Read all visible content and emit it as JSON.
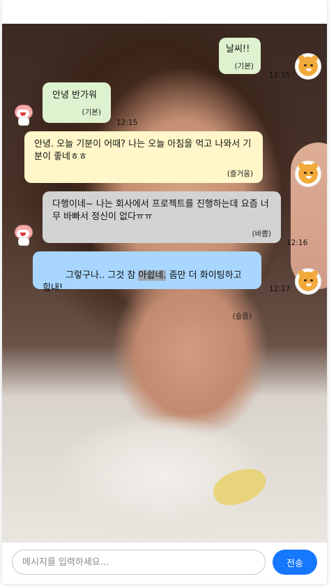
{
  "messages": [
    {
      "text": "날씨!!",
      "emotion": "(기본)",
      "time": "12:15"
    },
    {
      "text": "안녕 반가워",
      "emotion": "(기본)",
      "time": "12:15"
    },
    {
      "text": "안녕. 오늘 기분이 어때? 나는 오늘 아침을 먹고 나와서 기분이 좋네ㅎㅎ",
      "emotion": "(즐거움)",
      "time": ""
    },
    {
      "text": "다행이네~ 나는 회사에서 프로젝트를 진행하는데 요즘 너무 바빠서 정신이 없다ㅠㅠ",
      "emotion": "(바쁨)",
      "time": "12:16"
    },
    {
      "text_before": "그렇구나.. 그것 참 ",
      "text_highlight": "아쉽네.",
      "text_after": " 좀만 더 화이팅하고 힘내!",
      "emotion": "(슬픔)",
      "time": "12:17"
    }
  ],
  "composer": {
    "placeholder": "메시지를 입력하세요...",
    "send_label": "전송"
  },
  "colors": {
    "bubble_green": "#dff2cf",
    "bubble_yellow": "#fff7c9",
    "bubble_gray": "#d3d3d3",
    "bubble_blue": "#a9d6ff",
    "send_button": "#1677ff"
  },
  "icons": {
    "user_avatar": "ryan-bear-icon",
    "bot_avatar": "apeach-peach-icon"
  }
}
